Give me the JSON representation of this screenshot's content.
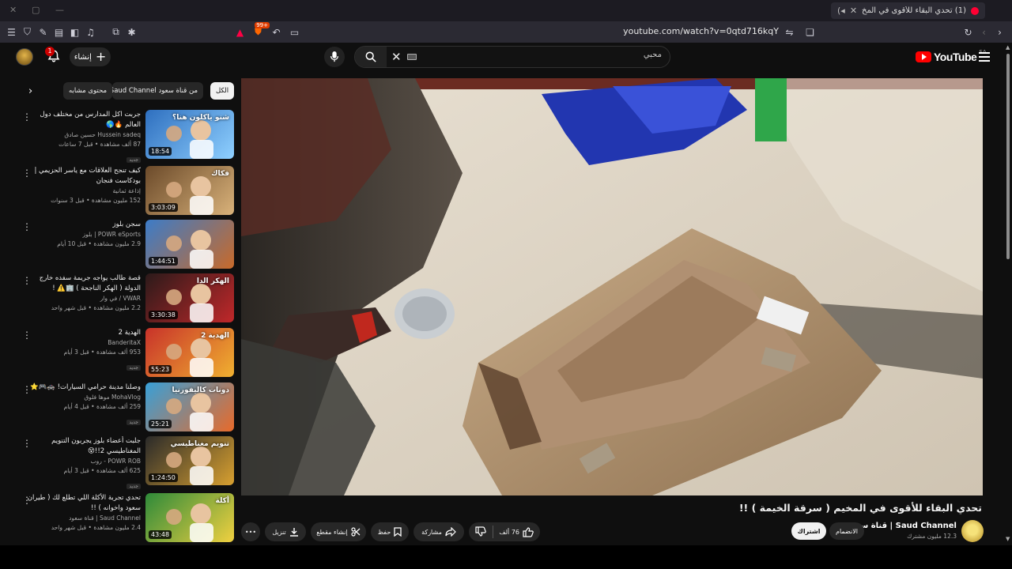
{
  "browser": {
    "tab_title": "(1) تحدي البقاء للأقوى في المخ...",
    "url": "youtube.com/watch?v=0qtd716kqY",
    "shield_badge": "99+"
  },
  "header": {
    "logo_text": "YouTube",
    "logo_country": "SA",
    "create_label": "إنشاء",
    "notifications_count": "1",
    "search_value": "محبي"
  },
  "chips": [
    {
      "label": "الكل"
    },
    {
      "label": "من قناة سعود"
    },
    {
      "label": "Saud Channel | "
    },
    {
      "label": "محتوى مشابه"
    }
  ],
  "recommendations": [
    {
      "title": "جربت اكل المدارس من مختلف دول العالم 🔥🌎",
      "channel": "Hussein sadeq حسين صادق",
      "stats": "87 ألف مشاهدة • قبل 7 ساعات",
      "badge": "جديد",
      "duration": "18:54",
      "thumb_text": "شنو ياكلون هنا؟"
    },
    {
      "title": "كيف تنجح العلاقات مع ياسر الحزيمي | بودكاست فنجان",
      "channel": "إذاعة ثمانية",
      "stats": "152 مليون مشاهدة • قبل 3 سنوات",
      "badge": "",
      "duration": "3:03:09",
      "thumb_text": "فكاك"
    },
    {
      "title": "سجن بلوز",
      "channel": "POWR eSports | بلوز",
      "stats": "2.9 مليون مشاهدة • قبل 10 أيام",
      "badge": "",
      "duration": "1:44:51",
      "thumb_text": ""
    },
    {
      "title": "قصة طالب يواجه جريمة سفده خارج الدولة ( الهكر الناجحة ) 🏢⚠️ !",
      "channel": "VWAR / في وار",
      "stats": "2.2 مليون مشاهدة • قبل شهر واحد",
      "badge": "",
      "duration": "3:30:38",
      "thumb_text": "الهكر الدا"
    },
    {
      "title": "الهدية 2",
      "channel": "BanderitaX",
      "stats": "953 ألف مشاهدة • قبل 3 أيام",
      "badge": "جديد",
      "duration": "55:23",
      "thumb_text": "الهدية 2"
    },
    {
      "title": "وصلنا مدينة حرامي السيارات! 🚓🎮⭐",
      "channel": "MohaVlog موها فلوق",
      "stats": "259 ألف مشاهدة • قبل 4 أيام",
      "badge": "جديد",
      "duration": "25:21",
      "thumb_text": "دونات كاليفورنيا"
    },
    {
      "title": "جلبت أعضاء بلوز يجربون التنويم المغناطيسي 2!!😵",
      "channel": "POWR ROB - روب",
      "stats": "625 ألف مشاهدة • قبل 3 أيام",
      "badge": "جديد",
      "duration": "1:24:50",
      "thumb_text": "تنويم مغناطيسي"
    },
    {
      "title": "تحدي تجربة الأكلة اللي تطلع لك ( طيران سعود واخوانه ) !!",
      "channel": "Saud Channel | قناة سعود",
      "stats": "2.4 مليون مشاهدة • قبل شهر واحد",
      "badge": "",
      "duration": "43:48",
      "thumb_text": "أكلة"
    }
  ],
  "video": {
    "title": "تحدي البقاء للأقوى في المخيم ( سرقة الخيمة ) !!",
    "channel_name": "Saud Channel | قناة سعود",
    "subscribers": "12.3 مليون مشترك",
    "join_label": "الانضمام",
    "subscribe_label": "اشتراك",
    "likes": "76 ألف",
    "share_label": "مشاركة",
    "save_label": "حفظ",
    "clip_label": "إنشاء مقطع",
    "download_label": "تنزيل"
  },
  "colors": {
    "accent": "#ff0000",
    "background": "#0f0f0f",
    "chip_bg": "#272727"
  }
}
